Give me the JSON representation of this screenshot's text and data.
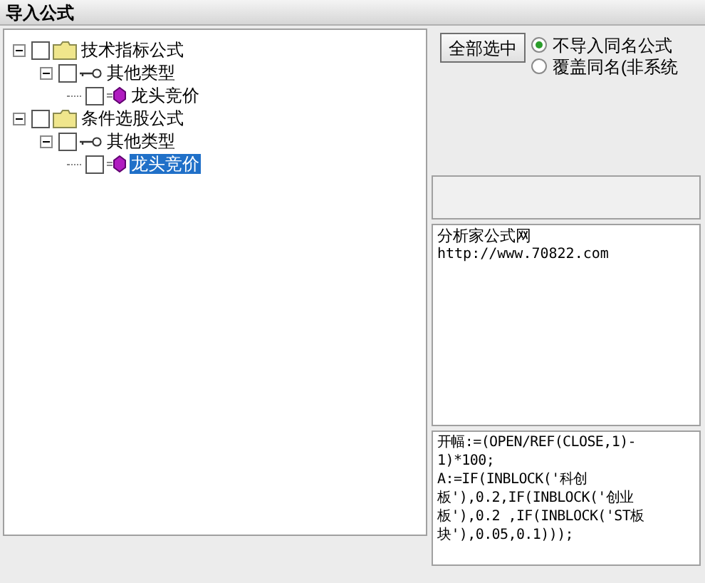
{
  "window": {
    "title": "导入公式"
  },
  "tree": [
    {
      "label": "技术指标公式",
      "kind": "folder",
      "checked": false,
      "expanded": true,
      "selected": false,
      "children": [
        {
          "label": "其他类型",
          "kind": "category",
          "checked": false,
          "expanded": true,
          "selected": false,
          "children": [
            {
              "label": "龙头竞价",
              "kind": "formula",
              "checked": false,
              "selected": false
            }
          ]
        }
      ]
    },
    {
      "label": "条件选股公式",
      "kind": "folder",
      "checked": false,
      "expanded": true,
      "selected": false,
      "children": [
        {
          "label": "其他类型",
          "kind": "category",
          "checked": false,
          "expanded": true,
          "selected": false,
          "children": [
            {
              "label": "龙头竞价",
              "kind": "formula",
              "checked": false,
              "selected": true
            }
          ]
        }
      ]
    }
  ],
  "select_all_button": "全部选中",
  "options": [
    {
      "label": "不导入同名公式",
      "selected": true
    },
    {
      "label": "覆盖同名(非系统",
      "selected": false
    }
  ],
  "description": [
    "分析家公式网",
    "http://www.70822.com"
  ],
  "formula_text": [
    "开幅:=(OPEN/REF(CLOSE,1)-",
    "1)*100;",
    "A:=IF(INBLOCK('科创",
    "板'),0.2,IF(INBLOCK('创业",
    "板'),0.2 ,IF(INBLOCK('ST板",
    "块'),0.05,0.1)));"
  ]
}
